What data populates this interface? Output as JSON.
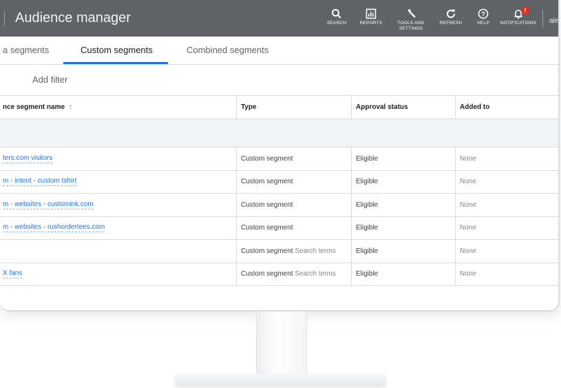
{
  "header": {
    "title": "Audience manager",
    "tools": [
      {
        "icon": "search-icon",
        "glyph": "⚲",
        "label": "SEARCH"
      },
      {
        "icon": "reports-icon",
        "glyph": "▥",
        "label": "REPORTS"
      },
      {
        "icon": "wrench-icon",
        "glyph": "🔧",
        "label": "TOOLS AND SETTINGS"
      },
      {
        "icon": "refresh-icon",
        "glyph": "↻",
        "label": "REFRESH"
      },
      {
        "icon": "help-icon",
        "glyph": "?",
        "label": "HELP"
      },
      {
        "icon": "bell-icon",
        "glyph": "🔔",
        "label": "NOTIFICATIONS"
      }
    ],
    "notification_badge": "!",
    "account_partial": "ale"
  },
  "tabs": [
    {
      "label": "a segments"
    },
    {
      "label": "Custom segments",
      "active": true
    },
    {
      "label": "Combined segments"
    }
  ],
  "filter": {
    "label": "Add filter"
  },
  "table": {
    "columns": [
      "nce segment name",
      "Type",
      "Approval status",
      "Added to"
    ],
    "sort_glyph": "↑",
    "rows": [
      {
        "name": "ters.com visitors",
        "type": "Custom segment",
        "type_sub": "",
        "status": "Eligible",
        "added": "None"
      },
      {
        "name": "m - intent - custom tshirt",
        "type": "Custom segment",
        "type_sub": "",
        "status": "Eligible",
        "added": "None"
      },
      {
        "name": "m - websites - customink.com",
        "type": "Custom segment",
        "type_sub": "",
        "status": "Eligible",
        "added": "None"
      },
      {
        "name": "m - websites - rushordertees.com",
        "type": "Custom segment",
        "type_sub": "",
        "status": "Eligible",
        "added": "None"
      },
      {
        "name": "",
        "type": "Custom segment",
        "type_sub": "Search terms",
        "status": "Eligible",
        "added": "None"
      },
      {
        "name": "X fans",
        "type": "Custom segment",
        "type_sub": "Search terms",
        "status": "Eligible",
        "added": "None"
      }
    ]
  },
  "colors": {
    "header_bg": "#5f6368",
    "accent": "#1a73e8",
    "badge": "#d93025"
  }
}
